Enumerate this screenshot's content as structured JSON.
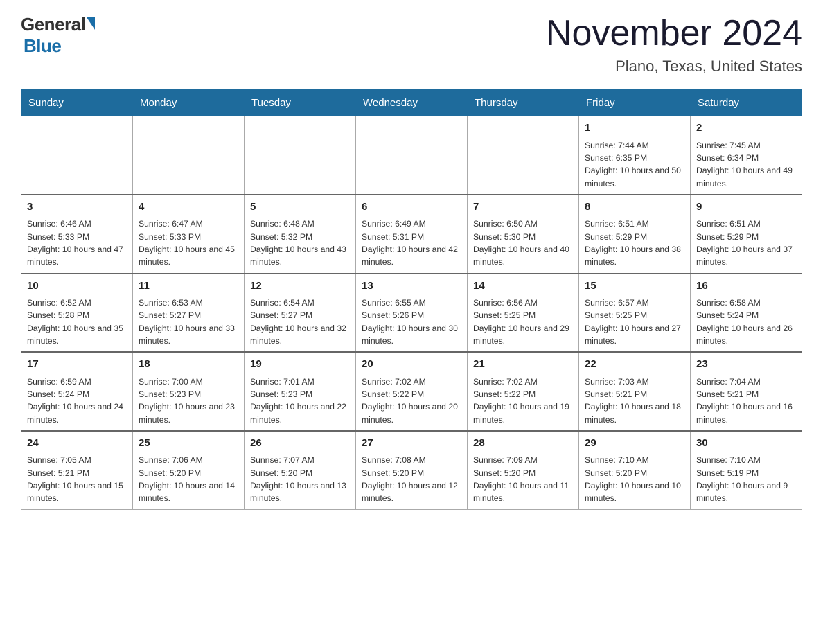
{
  "logo": {
    "general": "General",
    "blue": "Blue",
    "triangle_color": "#1a6ea8"
  },
  "title": "November 2024",
  "location": "Plano, Texas, United States",
  "weekdays": [
    "Sunday",
    "Monday",
    "Tuesday",
    "Wednesday",
    "Thursday",
    "Friday",
    "Saturday"
  ],
  "weeks": [
    [
      {
        "day": "",
        "info": ""
      },
      {
        "day": "",
        "info": ""
      },
      {
        "day": "",
        "info": ""
      },
      {
        "day": "",
        "info": ""
      },
      {
        "day": "",
        "info": ""
      },
      {
        "day": "1",
        "info": "Sunrise: 7:44 AM\nSunset: 6:35 PM\nDaylight: 10 hours and 50 minutes."
      },
      {
        "day": "2",
        "info": "Sunrise: 7:45 AM\nSunset: 6:34 PM\nDaylight: 10 hours and 49 minutes."
      }
    ],
    [
      {
        "day": "3",
        "info": "Sunrise: 6:46 AM\nSunset: 5:33 PM\nDaylight: 10 hours and 47 minutes."
      },
      {
        "day": "4",
        "info": "Sunrise: 6:47 AM\nSunset: 5:33 PM\nDaylight: 10 hours and 45 minutes."
      },
      {
        "day": "5",
        "info": "Sunrise: 6:48 AM\nSunset: 5:32 PM\nDaylight: 10 hours and 43 minutes."
      },
      {
        "day": "6",
        "info": "Sunrise: 6:49 AM\nSunset: 5:31 PM\nDaylight: 10 hours and 42 minutes."
      },
      {
        "day": "7",
        "info": "Sunrise: 6:50 AM\nSunset: 5:30 PM\nDaylight: 10 hours and 40 minutes."
      },
      {
        "day": "8",
        "info": "Sunrise: 6:51 AM\nSunset: 5:29 PM\nDaylight: 10 hours and 38 minutes."
      },
      {
        "day": "9",
        "info": "Sunrise: 6:51 AM\nSunset: 5:29 PM\nDaylight: 10 hours and 37 minutes."
      }
    ],
    [
      {
        "day": "10",
        "info": "Sunrise: 6:52 AM\nSunset: 5:28 PM\nDaylight: 10 hours and 35 minutes."
      },
      {
        "day": "11",
        "info": "Sunrise: 6:53 AM\nSunset: 5:27 PM\nDaylight: 10 hours and 33 minutes."
      },
      {
        "day": "12",
        "info": "Sunrise: 6:54 AM\nSunset: 5:27 PM\nDaylight: 10 hours and 32 minutes."
      },
      {
        "day": "13",
        "info": "Sunrise: 6:55 AM\nSunset: 5:26 PM\nDaylight: 10 hours and 30 minutes."
      },
      {
        "day": "14",
        "info": "Sunrise: 6:56 AM\nSunset: 5:25 PM\nDaylight: 10 hours and 29 minutes."
      },
      {
        "day": "15",
        "info": "Sunrise: 6:57 AM\nSunset: 5:25 PM\nDaylight: 10 hours and 27 minutes."
      },
      {
        "day": "16",
        "info": "Sunrise: 6:58 AM\nSunset: 5:24 PM\nDaylight: 10 hours and 26 minutes."
      }
    ],
    [
      {
        "day": "17",
        "info": "Sunrise: 6:59 AM\nSunset: 5:24 PM\nDaylight: 10 hours and 24 minutes."
      },
      {
        "day": "18",
        "info": "Sunrise: 7:00 AM\nSunset: 5:23 PM\nDaylight: 10 hours and 23 minutes."
      },
      {
        "day": "19",
        "info": "Sunrise: 7:01 AM\nSunset: 5:23 PM\nDaylight: 10 hours and 22 minutes."
      },
      {
        "day": "20",
        "info": "Sunrise: 7:02 AM\nSunset: 5:22 PM\nDaylight: 10 hours and 20 minutes."
      },
      {
        "day": "21",
        "info": "Sunrise: 7:02 AM\nSunset: 5:22 PM\nDaylight: 10 hours and 19 minutes."
      },
      {
        "day": "22",
        "info": "Sunrise: 7:03 AM\nSunset: 5:21 PM\nDaylight: 10 hours and 18 minutes."
      },
      {
        "day": "23",
        "info": "Sunrise: 7:04 AM\nSunset: 5:21 PM\nDaylight: 10 hours and 16 minutes."
      }
    ],
    [
      {
        "day": "24",
        "info": "Sunrise: 7:05 AM\nSunset: 5:21 PM\nDaylight: 10 hours and 15 minutes."
      },
      {
        "day": "25",
        "info": "Sunrise: 7:06 AM\nSunset: 5:20 PM\nDaylight: 10 hours and 14 minutes."
      },
      {
        "day": "26",
        "info": "Sunrise: 7:07 AM\nSunset: 5:20 PM\nDaylight: 10 hours and 13 minutes."
      },
      {
        "day": "27",
        "info": "Sunrise: 7:08 AM\nSunset: 5:20 PM\nDaylight: 10 hours and 12 minutes."
      },
      {
        "day": "28",
        "info": "Sunrise: 7:09 AM\nSunset: 5:20 PM\nDaylight: 10 hours and 11 minutes."
      },
      {
        "day": "29",
        "info": "Sunrise: 7:10 AM\nSunset: 5:20 PM\nDaylight: 10 hours and 10 minutes."
      },
      {
        "day": "30",
        "info": "Sunrise: 7:10 AM\nSunset: 5:19 PM\nDaylight: 10 hours and 9 minutes."
      }
    ]
  ]
}
